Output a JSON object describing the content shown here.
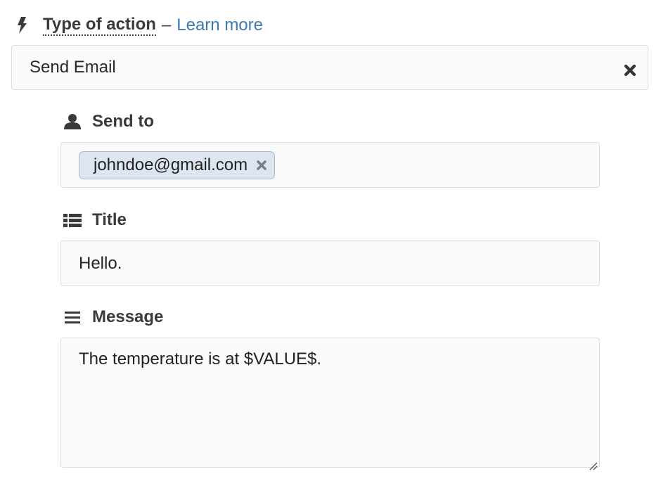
{
  "action": {
    "label": "Type of action",
    "separator": "–",
    "learn_more": "Learn more",
    "selected": "Send Email"
  },
  "send_to": {
    "label": "Send to",
    "recipients": [
      "johndoe@gmail.com"
    ]
  },
  "title": {
    "label": "Title",
    "value": "Hello."
  },
  "message": {
    "label": "Message",
    "value": "The temperature is at $VALUE$."
  },
  "colors": {
    "link": "#3b78b1",
    "tag_background": "#dde6f0",
    "tag_border": "#a9b9cc",
    "field_background": "#fafafa",
    "field_border": "#dddddd"
  }
}
